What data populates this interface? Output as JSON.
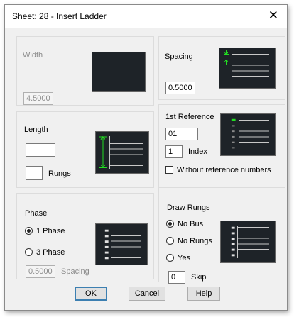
{
  "dialog": {
    "title": "Sheet: 28 - Insert Ladder",
    "close_glyph": "✕"
  },
  "width": {
    "label": "Width",
    "value": "4.5000"
  },
  "spacing": {
    "label": "Spacing",
    "value": "0.5000"
  },
  "length": {
    "label": "Length",
    "value": "",
    "rungs_label": "Rungs",
    "rungs_value": ""
  },
  "reference": {
    "label": "1st Reference",
    "value": "01",
    "index_value": "1",
    "index_label": "Index",
    "without_ref_label": "Without reference numbers",
    "without_ref_checked": false
  },
  "phase": {
    "label": "Phase",
    "options": [
      "1 Phase",
      "3 Phase"
    ],
    "selected": "1 Phase",
    "spacing_value": "0.5000",
    "spacing_label": "Spacing"
  },
  "draw_rungs": {
    "label": "Draw Rungs",
    "options": [
      "No Bus",
      "No Rungs",
      "Yes"
    ],
    "selected": "No Bus",
    "skip_value": "0",
    "skip_label": "Skip"
  },
  "buttons": {
    "ok": "OK",
    "cancel": "Cancel",
    "help": "Help"
  },
  "colors": {
    "preview_bg": "#1e2328",
    "rung_line": "#c8c8c8",
    "dimension_arrow": "#22dd22",
    "accent": "#3c7fb1"
  }
}
